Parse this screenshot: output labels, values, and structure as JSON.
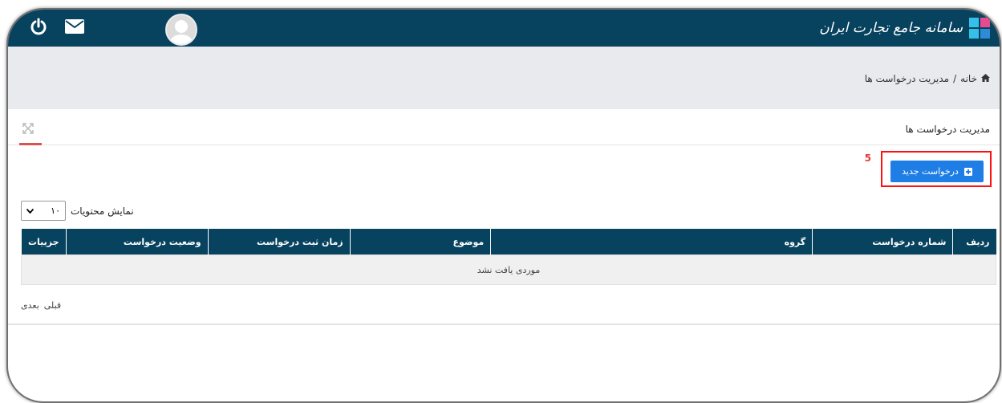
{
  "header": {
    "title": "سامانه جامع تجارت ایران",
    "icons": {
      "power": "power-icon",
      "mail": "mail-icon",
      "avatar": "user-avatar"
    }
  },
  "breadcrumb": {
    "home": "خانه",
    "separator": "/",
    "current": "مدیریت درخواست ها"
  },
  "panel": {
    "title": "مدیریت درخواست ها"
  },
  "toolbar": {
    "new_request_label": "درخواست جدید",
    "step_marker": "5"
  },
  "length_control": {
    "label": "نمایش محتویات",
    "selected": "۱۰"
  },
  "table": {
    "columns": [
      "ردیف",
      "شماره درخواست",
      "گروه",
      "موضوع",
      "زمان ثبت درخواست",
      "وضعیت درخواست",
      "جزییات"
    ],
    "empty_message": "موردی یافت نشد"
  },
  "pagination": {
    "previous": "قبلی",
    "next": "بعدی"
  },
  "colors": {
    "header_bg": "#07425f",
    "button_bg": "#1f7ee6",
    "highlight": "#ff1010",
    "tab_accent": "#d9534f"
  }
}
